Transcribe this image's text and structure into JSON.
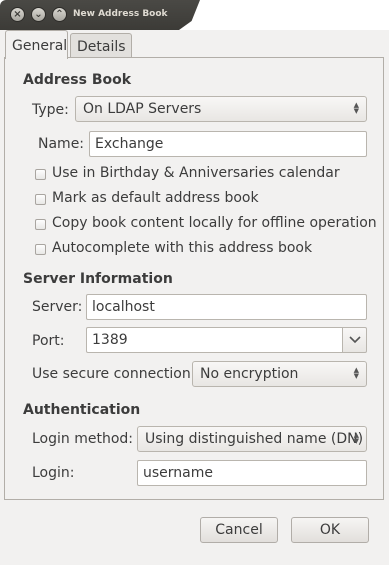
{
  "window": {
    "title": "New Address Book"
  },
  "tabs": [
    {
      "label": "General"
    },
    {
      "label": "Details"
    }
  ],
  "address_book": {
    "title": "Address Book",
    "type_label": "Type:",
    "type_value": "On LDAP Servers",
    "name_label": "Name:",
    "name_value": "Exchange",
    "options": [
      {
        "label": "Use in Birthday & Anniversaries calendar",
        "checked": false
      },
      {
        "label": "Mark as default address book",
        "checked": false
      },
      {
        "label": "Copy book content locally for offline operation",
        "checked": false
      },
      {
        "label": "Autocomplete with this address book",
        "checked": false
      }
    ]
  },
  "server": {
    "title": "Server Information",
    "server_label": "Server:",
    "server_value": "localhost",
    "port_label": "Port:",
    "port_value": "1389",
    "secure_label": "Use secure connection:",
    "secure_value": "No encryption"
  },
  "auth": {
    "title": "Authentication",
    "method_label": "Login method:",
    "method_value": "Using distinguished name (DN)",
    "login_label": "Login:",
    "login_value": "username"
  },
  "buttons": {
    "cancel": "Cancel",
    "ok": "OK"
  }
}
